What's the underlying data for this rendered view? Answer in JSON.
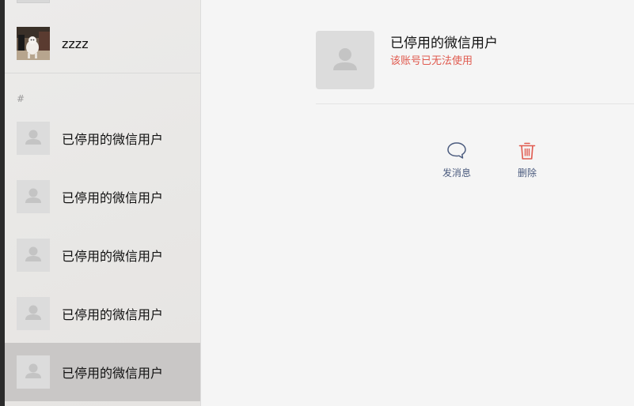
{
  "sidebar": {
    "top_contact": {
      "name": "zzzz",
      "avatar": "photo-avatar"
    },
    "section_letter": "#",
    "contacts": [
      {
        "name": "已停用的微信用户",
        "avatar": "default-person-icon",
        "selected": false
      },
      {
        "name": "已停用的微信用户",
        "avatar": "default-person-icon",
        "selected": false
      },
      {
        "name": "已停用的微信用户",
        "avatar": "default-person-icon",
        "selected": false
      },
      {
        "name": "已停用的微信用户",
        "avatar": "default-person-icon",
        "selected": false
      },
      {
        "name": "已停用的微信用户",
        "avatar": "default-person-icon",
        "selected": true
      }
    ]
  },
  "detail": {
    "name": "已停用的微信用户",
    "status": "该账号已无法使用",
    "actions": {
      "message_label": "发消息",
      "delete_label": "删除"
    }
  },
  "colors": {
    "status_red": "#e05a4f",
    "action_blue": "#4b5b7e",
    "selected_bg": "#c9c7c6"
  }
}
